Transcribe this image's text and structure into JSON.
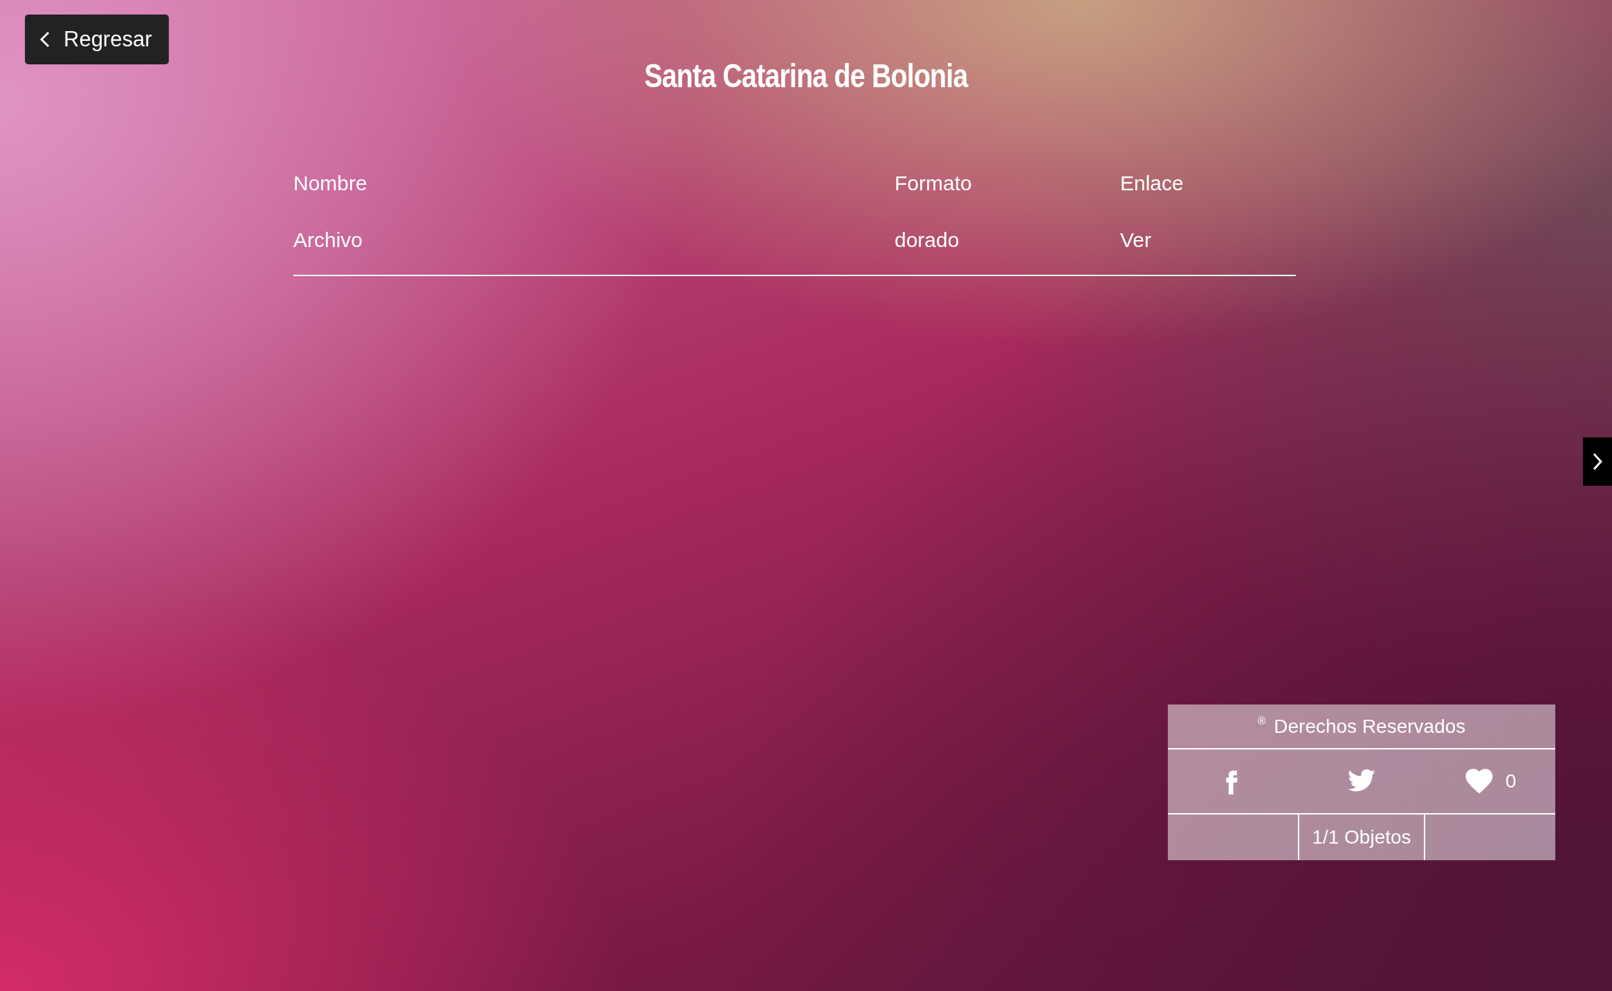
{
  "back_button": {
    "label": "Regresar"
  },
  "title": "Santa Catarina de Bolonia",
  "table": {
    "columns": [
      "Nombre",
      "Formato",
      "Enlace"
    ],
    "rows": [
      [
        "Archivo",
        "dorado",
        "Ver"
      ]
    ]
  },
  "footer": {
    "rights": "$^{®}$ Derechos Reservados",
    "likes": "0",
    "objects": "1/1 Objetos"
  }
}
